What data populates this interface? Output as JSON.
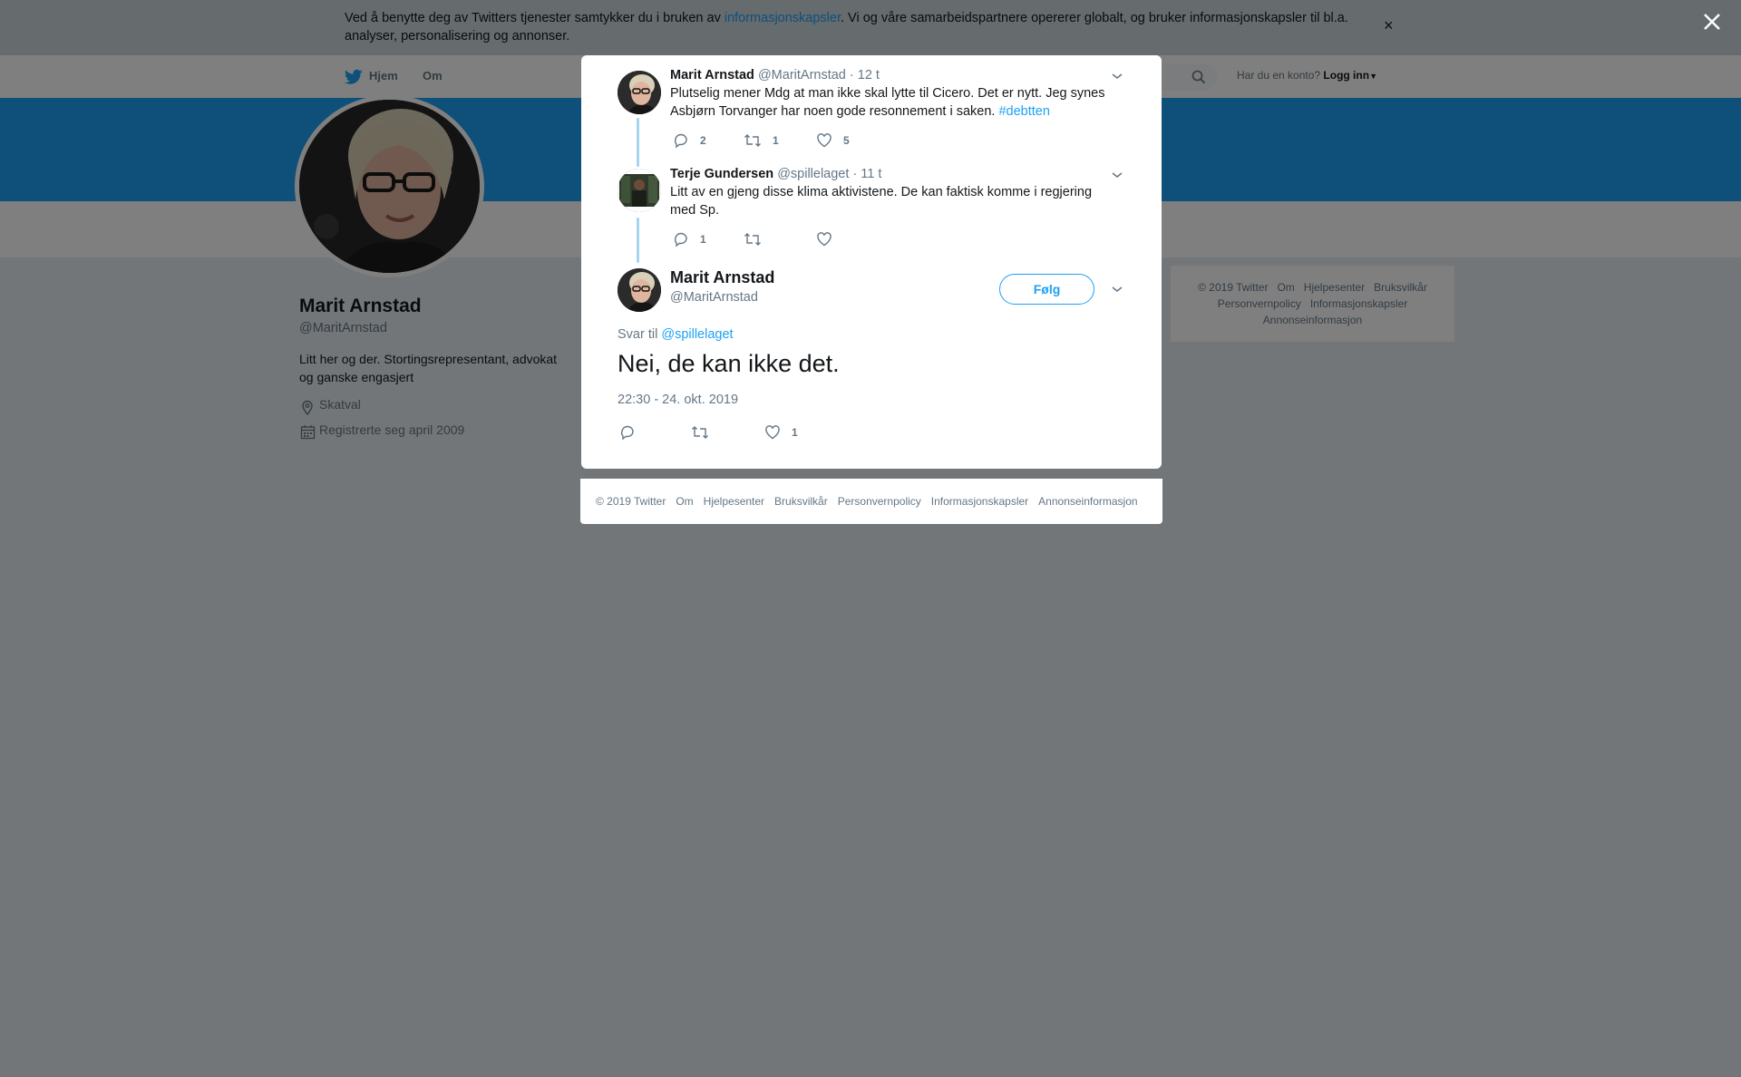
{
  "cookie": {
    "text_before": "Ved å benytte deg av Twitters tjenester samtykker du i bruken av ",
    "link": "informasjonskapsler",
    "text_after": ". Vi og våre samarbeidspartnere opererer globalt, og bruker informasjonskapsler til bl.a. analyser, personalisering og annonser.",
    "close": "×"
  },
  "nav": {
    "home": "Hjem",
    "about": "Om",
    "account_prompt": "Har du en konto?",
    "login": "Logg inn"
  },
  "profile": {
    "name": "Marit Arnstad",
    "handle": "@MaritArnstad",
    "bio": "Litt her og der. Stortingsrepresentant, advokat og ganske engasjert",
    "location": "Skatval",
    "joined": "Registrerte seg april 2009"
  },
  "footer": {
    "items": [
      "© 2019 Twitter",
      "Om",
      "Hjelpesenter",
      "Bruksvilkår",
      "Personvernpolicy",
      "Informasjonskapsler",
      "Annonseinformasjon"
    ]
  },
  "thread": [
    {
      "name": "Marit Arnstad",
      "handle": "@MaritArnstad",
      "time": "· 12 t",
      "text": "Plutselig mener Mdg at man ikke skal lytte til Cicero. Det er nytt. Jeg synes Asbjørn Torvanger har noen gode resonnement i saken. ",
      "hashtag": "#debtten",
      "replies": "2",
      "retweets": "1",
      "likes": "5"
    },
    {
      "name": "Terje Gundersen",
      "handle": "@spillelaget",
      "time": "· 11 t",
      "text": "Litt av en gjeng disse klima aktivistene. De kan faktisk komme i regjering med Sp.",
      "replies": "1",
      "retweets": "",
      "likes": ""
    }
  ],
  "main_tweet": {
    "name": "Marit Arnstad",
    "handle": "@MaritArnstad",
    "follow": "Følg",
    "reply_prefix": "Svar til ",
    "reply_to": "@spillelaget",
    "text": "Nei, de kan ikke det.",
    "timestamp": "22:30 - 24. okt. 2019",
    "replies": "",
    "retweets": "",
    "likes": "1"
  },
  "colors": {
    "accent": "#1da1f2",
    "overlay": "rgba(0,0,0,0.5)",
    "thread_line": "#a6d3f2"
  }
}
